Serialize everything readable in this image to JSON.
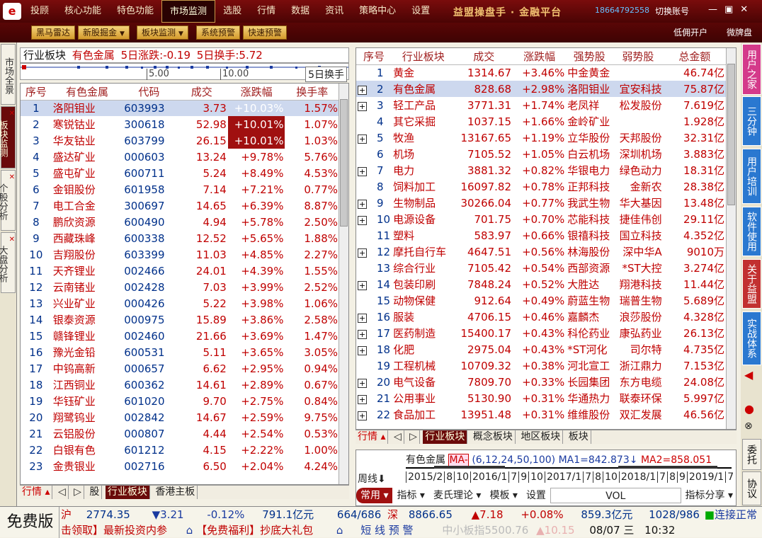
{
  "menu": [
    "投顾",
    "核心功能",
    "特色功能",
    "市场监测",
    "选股",
    "行情",
    "数据",
    "资讯",
    "策略中心",
    "设置"
  ],
  "menu_active": "市场监测",
  "brand": "益盟操盘手 · 金融平台",
  "phone": "18664792558",
  "switch_account": "切换账号",
  "toolbar": [
    {
      "label": "黑马雷达",
      "dd": false
    },
    {
      "label": "新股掘金",
      "dd": true
    },
    {
      "label": "板块监测",
      "dd": true
    },
    {
      "label": "系统预警",
      "dd": false
    },
    {
      "label": "快速预警",
      "dd": false
    }
  ],
  "toolbar_right": [
    "低佣开户",
    "微牌盘"
  ],
  "left_tabs": [
    "市场全景",
    "板块监测",
    "个股分析",
    "大盘分析"
  ],
  "sector_header": {
    "sector": "行业板块",
    "name": "有色金属",
    "chg": "5日涨跌:-0.19",
    "turn": "5日换手:5.72"
  },
  "timeline": {
    "t1": "5.00",
    "t2": "10.00",
    "label": "5日换手"
  },
  "stock_cols": [
    "序号",
    "有色金属",
    "代码",
    "成交",
    "涨跌幅",
    "换手率"
  ],
  "stocks": [
    {
      "n": "1",
      "name": "洛阳钼业",
      "code": "603993",
      "price": "3.73",
      "chg": "+10.03%",
      "turn": "1.57%",
      "hl": true,
      "limit": true
    },
    {
      "n": "2",
      "name": "寒锐钴业",
      "code": "300618",
      "price": "52.98",
      "chg": "+10.01%",
      "turn": "1.07%",
      "limit": true
    },
    {
      "n": "3",
      "name": "华友钴业",
      "code": "603799",
      "price": "26.15",
      "chg": "+10.01%",
      "turn": "1.03%",
      "limit": true
    },
    {
      "n": "4",
      "name": "盛达矿业",
      "code": "000603",
      "price": "13.24",
      "chg": "+9.78%",
      "turn": "5.76%"
    },
    {
      "n": "5",
      "name": "盛屯矿业",
      "code": "600711",
      "price": "5.24",
      "chg": "+8.49%",
      "turn": "4.53%"
    },
    {
      "n": "6",
      "name": "金钼股份",
      "code": "601958",
      "price": "7.14",
      "chg": "+7.21%",
      "turn": "0.77%"
    },
    {
      "n": "7",
      "name": "电工合金",
      "code": "300697",
      "price": "14.65",
      "chg": "+6.39%",
      "turn": "8.87%"
    },
    {
      "n": "8",
      "name": "鹏欣资源",
      "code": "600490",
      "price": "4.94",
      "chg": "+5.78%",
      "turn": "2.50%"
    },
    {
      "n": "9",
      "name": "西藏珠峰",
      "code": "600338",
      "price": "12.52",
      "chg": "+5.65%",
      "turn": "1.88%"
    },
    {
      "n": "10",
      "name": "吉翔股份",
      "code": "603399",
      "price": "11.03",
      "chg": "+4.85%",
      "turn": "2.27%"
    },
    {
      "n": "11",
      "name": "天齐锂业",
      "code": "002466",
      "price": "24.01",
      "chg": "+4.39%",
      "turn": "1.55%"
    },
    {
      "n": "12",
      "name": "云南锗业",
      "code": "002428",
      "price": "7.03",
      "chg": "+3.99%",
      "turn": "2.52%"
    },
    {
      "n": "13",
      "name": "兴业矿业",
      "code": "000426",
      "price": "5.22",
      "chg": "+3.98%",
      "turn": "1.06%"
    },
    {
      "n": "14",
      "name": "银泰资源",
      "code": "000975",
      "price": "15.89",
      "chg": "+3.86%",
      "turn": "2.58%"
    },
    {
      "n": "15",
      "name": "赣锋锂业",
      "code": "002460",
      "price": "21.66",
      "chg": "+3.69%",
      "turn": "1.47%"
    },
    {
      "n": "16",
      "name": "豫光金铅",
      "code": "600531",
      "price": "5.11",
      "chg": "+3.65%",
      "turn": "3.05%"
    },
    {
      "n": "17",
      "name": "中钨高新",
      "code": "000657",
      "price": "6.62",
      "chg": "+2.95%",
      "turn": "0.94%"
    },
    {
      "n": "18",
      "name": "江西铜业",
      "code": "600362",
      "price": "14.61",
      "chg": "+2.89%",
      "turn": "0.67%"
    },
    {
      "n": "19",
      "name": "华钰矿业",
      "code": "601020",
      "price": "9.70",
      "chg": "+2.75%",
      "turn": "0.84%"
    },
    {
      "n": "20",
      "name": "翔鹭钨业",
      "code": "002842",
      "price": "14.67",
      "chg": "+2.59%",
      "turn": "9.75%"
    },
    {
      "n": "21",
      "name": "云铝股份",
      "code": "000807",
      "price": "4.44",
      "chg": "+2.54%",
      "turn": "0.53%"
    },
    {
      "n": "22",
      "name": "白银有色",
      "code": "601212",
      "price": "4.15",
      "chg": "+2.22%",
      "turn": "1.00%"
    },
    {
      "n": "23",
      "name": "金贵银业",
      "code": "002716",
      "price": "6.50",
      "chg": "+2.04%",
      "turn": "4.24%"
    }
  ],
  "left_tabstrip": [
    "行情",
    "股",
    "行业板块",
    "香港主板"
  ],
  "sector_cols": [
    "序号",
    "行业板块",
    "成交",
    "涨跌幅",
    "强势股",
    "弱势股",
    "总金额"
  ],
  "sectors": [
    {
      "n": "1",
      "name": "黄金",
      "price": "1314.67",
      "chg": "+3.46%",
      "strong": "中金黄金",
      "weak": "",
      "amt": "46.74亿",
      "plus": false
    },
    {
      "n": "2",
      "name": "有色金属",
      "price": "828.68",
      "chg": "+2.98%",
      "strong": "洛阳钼业",
      "weak": "宜安科技",
      "amt": "75.87亿",
      "plus": true,
      "hl": true
    },
    {
      "n": "3",
      "name": "轻工产品",
      "price": "3771.31",
      "chg": "+1.74%",
      "strong": "老凤祥",
      "weak": "松发股份",
      "amt": "7.619亿",
      "plus": true
    },
    {
      "n": "4",
      "name": "其它采掘",
      "price": "1037.15",
      "chg": "+1.66%",
      "strong": "金岭矿业",
      "weak": "",
      "amt": "1.928亿",
      "plus": false
    },
    {
      "n": "5",
      "name": "牧渔",
      "price": "13167.65",
      "chg": "+1.19%",
      "strong": "立华股份",
      "weak": "天邦股份",
      "amt": "32.31亿",
      "plus": true
    },
    {
      "n": "6",
      "name": "机场",
      "price": "7105.52",
      "chg": "+1.05%",
      "strong": "白云机场",
      "weak": "深圳机场",
      "amt": "3.883亿",
      "plus": false
    },
    {
      "n": "7",
      "name": "电力",
      "price": "3881.32",
      "chg": "+0.82%",
      "strong": "华银电力",
      "weak": "绿色动力",
      "amt": "18.31亿",
      "plus": true
    },
    {
      "n": "8",
      "name": "饲料加工",
      "price": "16097.82",
      "chg": "+0.78%",
      "strong": "正邦科技",
      "weak": "金新农",
      "amt": "28.38亿",
      "plus": false
    },
    {
      "n": "9",
      "name": "生物制品",
      "price": "30266.04",
      "chg": "+0.77%",
      "strong": "我武生物",
      "weak": "华大基因",
      "amt": "13.48亿",
      "plus": true
    },
    {
      "n": "10",
      "name": "电源设备",
      "price": "701.75",
      "chg": "+0.70%",
      "strong": "芯能科技",
      "weak": "捷佳伟创",
      "amt": "29.11亿",
      "plus": true
    },
    {
      "n": "11",
      "name": "塑料",
      "price": "583.97",
      "chg": "+0.66%",
      "strong": "银禧科技",
      "weak": "国立科技",
      "amt": "4.352亿",
      "plus": false
    },
    {
      "n": "12",
      "name": "摩托自行车",
      "price": "4647.51",
      "chg": "+0.56%",
      "strong": "林海股份",
      "weak": "深中华A",
      "amt": "9010万",
      "plus": true
    },
    {
      "n": "13",
      "name": "综合行业",
      "price": "7105.42",
      "chg": "+0.54%",
      "strong": "西部资源",
      "weak": "*ST大控",
      "amt": "3.274亿",
      "plus": false
    },
    {
      "n": "14",
      "name": "包装印刷",
      "price": "7848.24",
      "chg": "+0.52%",
      "strong": "大胜达",
      "weak": "翔港科技",
      "amt": "11.44亿",
      "plus": true
    },
    {
      "n": "15",
      "name": "动物保健",
      "price": "912.64",
      "chg": "+0.49%",
      "strong": "蔚蓝生物",
      "weak": "瑞普生物",
      "amt": "5.689亿",
      "plus": false
    },
    {
      "n": "16",
      "name": "服装",
      "price": "4706.15",
      "chg": "+0.46%",
      "strong": "嘉麟杰",
      "weak": "浪莎股份",
      "amt": "4.328亿",
      "plus": true
    },
    {
      "n": "17",
      "name": "医药制造",
      "price": "15400.17",
      "chg": "+0.43%",
      "strong": "科伦药业",
      "weak": "康弘药业",
      "amt": "26.13亿",
      "plus": true
    },
    {
      "n": "18",
      "name": "化肥",
      "price": "2975.04",
      "chg": "+0.43%",
      "strong": "*ST河化",
      "weak": "司尔特",
      "amt": "4.735亿",
      "plus": true
    },
    {
      "n": "19",
      "name": "工程机械",
      "price": "10709.32",
      "chg": "+0.38%",
      "strong": "河北宣工",
      "weak": "浙江鼎力",
      "amt": "7.153亿",
      "plus": false
    },
    {
      "n": "20",
      "name": "电气设备",
      "price": "7809.70",
      "chg": "+0.33%",
      "strong": "长园集团",
      "weak": "东方电缆",
      "amt": "24.08亿",
      "plus": true
    },
    {
      "n": "21",
      "name": "公用事业",
      "price": "5130.90",
      "chg": "+0.31%",
      "strong": "华通热力",
      "weak": "联泰环保",
      "amt": "5.997亿",
      "plus": true
    },
    {
      "n": "22",
      "name": "食品加工",
      "price": "13951.48",
      "chg": "+0.31%",
      "strong": "维维股份",
      "weak": "双汇发展",
      "amt": "46.56亿",
      "plus": true
    }
  ],
  "right_tabstrip": [
    "行情",
    "行业板块",
    "概念板块",
    "地区板块",
    "板块"
  ],
  "kline": {
    "name": "有色金属",
    "ma_box": "MA-",
    "ma_params": "(6,12,24,50,100)",
    "ma1": "MA1=842.873",
    "ma2": "MA2=858.051",
    "period": "周线",
    "dates": [
      "2015/2",
      "8",
      "10",
      "2016/1",
      "7",
      "9",
      "10",
      "2017/1",
      "7",
      "8",
      "10",
      "2018/1",
      "7",
      "8",
      "9",
      "2019/1",
      "7"
    ],
    "btns": [
      "常用",
      "指标",
      "麦氏理论",
      "模板",
      "设置",
      "VOL",
      "指标分享"
    ]
  },
  "right_sidebar": [
    {
      "label": "用户之家",
      "color": "#d43a8a"
    },
    {
      "label": "三分钟",
      "color": "#2a78d0"
    },
    {
      "label": "用户培训",
      "color": "#2a78d0"
    },
    {
      "label": "软件使用",
      "color": "#2a78d0"
    },
    {
      "label": "关于益盟",
      "color": "#c23030"
    },
    {
      "label": "实战体系",
      "color": "#2a78d0"
    }
  ],
  "right_sidebar_small": [
    "委托",
    "协议"
  ],
  "status": {
    "free": "免费版",
    "sh_label": "沪",
    "sh_idx": "2774.35",
    "sh_chg": "▼3.21",
    "sh_pct": "-0.12%",
    "sh_amt": "791.1亿元",
    "sh_cnt": "664/686",
    "sz_label": "深",
    "sz_idx": "8866.65",
    "sz_chg": "▲7.18",
    "sz_pct": "+0.08%",
    "sz_amt": "859.3亿元",
    "sz_cnt": "1028/986",
    "conn": "连接正常",
    "ticker1": "击领取】最新投资内参",
    "ticker2": "【免费福利】抄底大礼包",
    "alert": "短 线 预 警",
    "smb": "中小板指5500.76",
    "smb_chg": "▲10.15",
    "date": "08/07 三",
    "time": "10:32"
  }
}
